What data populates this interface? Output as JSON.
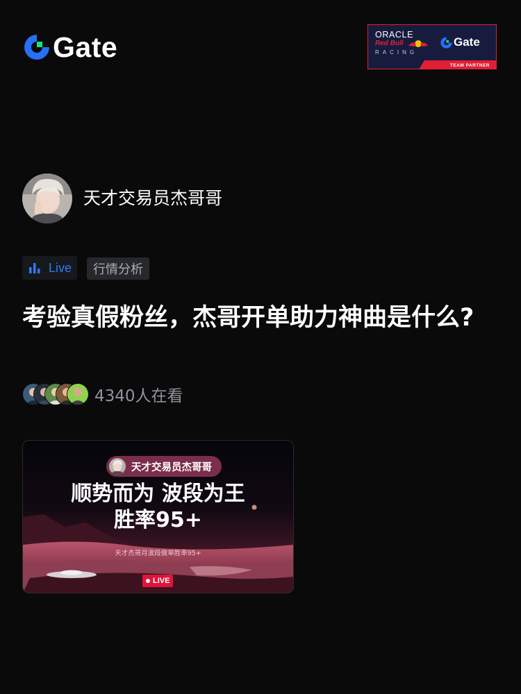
{
  "header": {
    "brand_name": "Gate",
    "partner_badge": {
      "line1": "ORACLE",
      "line2": "Red Bull",
      "line3": "RACING",
      "brand": "Gate",
      "footer": "TEAM PARTNER"
    }
  },
  "author": {
    "name": "天才交易员杰哥哥"
  },
  "tags": {
    "live_label": "Live",
    "category_label": "行情分析"
  },
  "post": {
    "title": "考验真假粉丝，杰哥开单助力神曲是什么?"
  },
  "viewers": {
    "count_text": "4340人在看"
  },
  "live_cover": {
    "host_name": "天才交易员杰哥哥",
    "headline_line1": "顺势而为 波段为王",
    "headline_line2": "胜率95+",
    "subtext": "天才杰哥月波段做单胜率95+",
    "live_badge": "LIVE"
  },
  "colors": {
    "background": "#0a0a0b",
    "gate_green": "#17e37a",
    "gate_blue": "#2670f5",
    "live_blue": "#2c7df3",
    "live_red": "#e0143b",
    "host_pill": "#7b2e49"
  }
}
